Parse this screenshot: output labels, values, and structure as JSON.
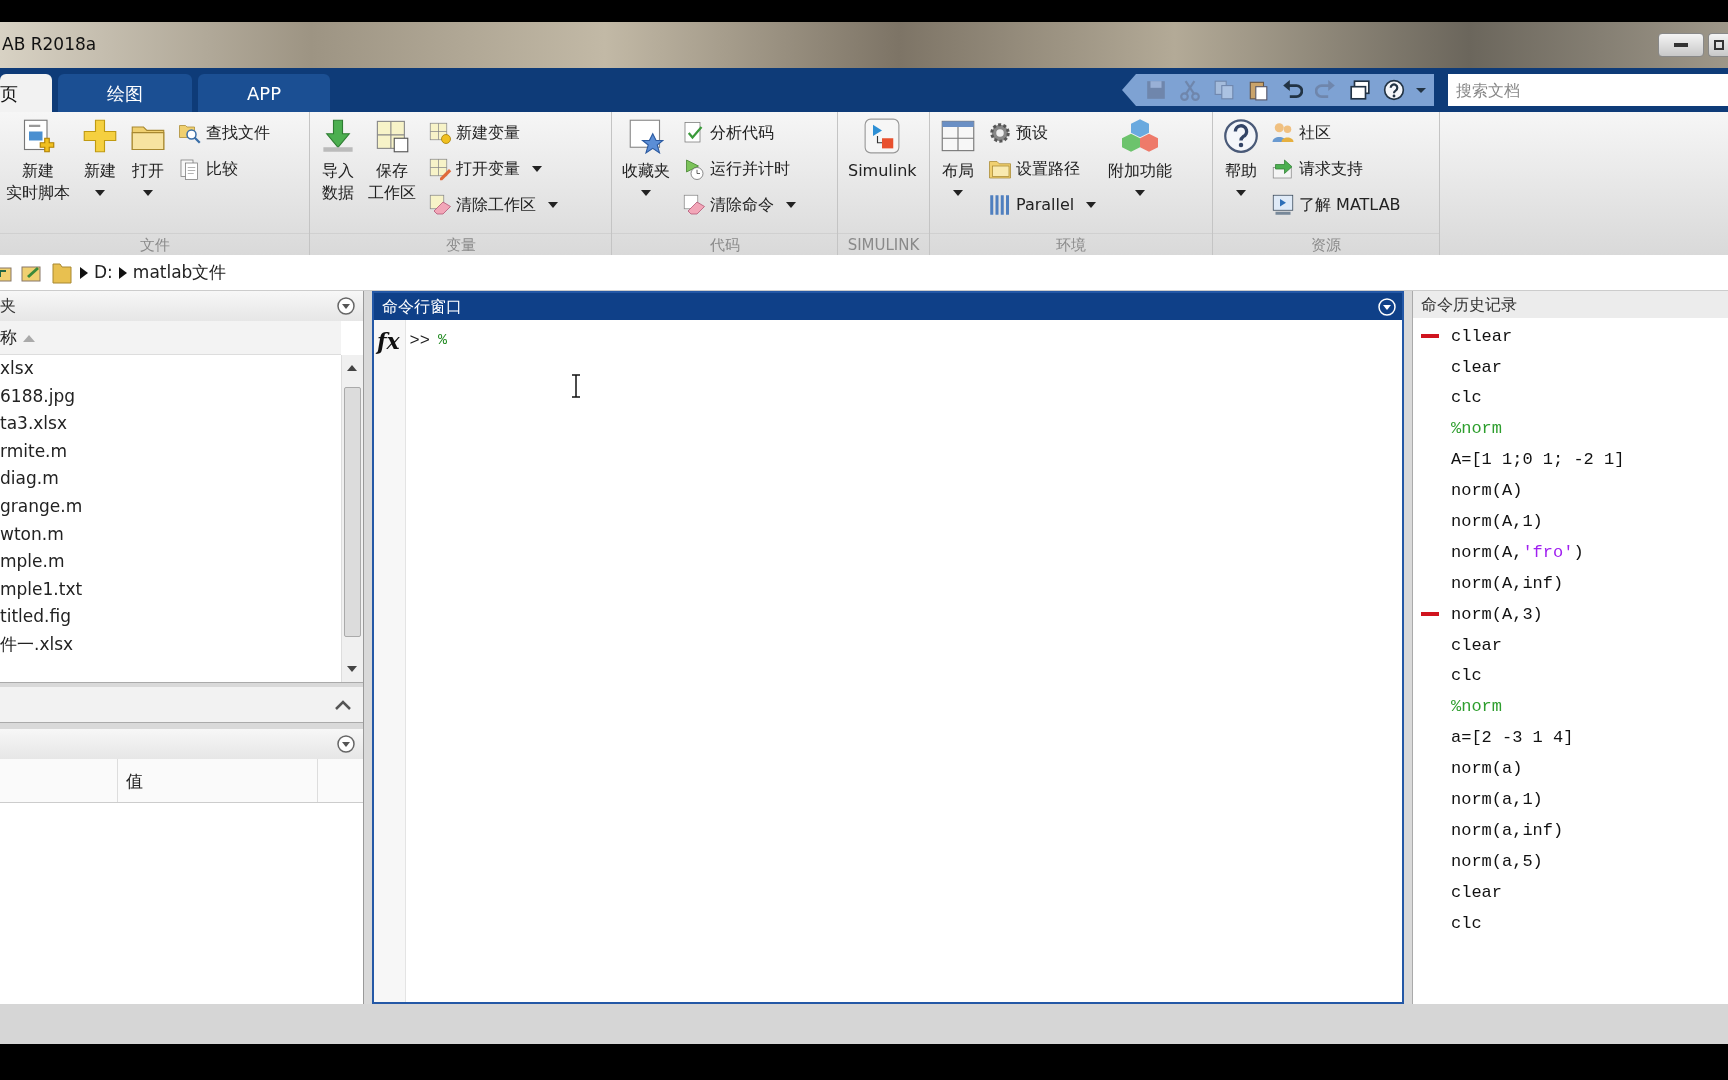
{
  "window": {
    "title": "AB R2018a"
  },
  "tabs": [
    {
      "label": "页",
      "selected": true
    },
    {
      "label": "绘图",
      "selected": false
    },
    {
      "label": "APP",
      "selected": false
    }
  ],
  "quick_access": [
    {
      "disabled": true
    },
    {
      "disabled": true
    },
    {
      "disabled": true
    },
    {
      "disabled": false
    },
    {
      "disabled": false
    },
    {
      "disabled": true
    },
    {
      "disabled": false
    },
    {
      "disabled": false
    },
    {
      "disabled": false
    }
  ],
  "search": {
    "placeholder": "搜索文档"
  },
  "ribbon": {
    "groups": [
      {
        "title": "文件",
        "items": [
          {
            "kind": "large",
            "lines": [
              "新建",
              "实时脚本"
            ],
            "dropdown": false
          },
          {
            "kind": "large",
            "lines": [
              "新建"
            ],
            "dropdown": true
          },
          {
            "kind": "large",
            "lines": [
              "打开"
            ],
            "dropdown": true
          },
          {
            "kind": "stack",
            "items": [
              {
                "label": "查找文件",
                "dropdown": false
              },
              {
                "label": "比较",
                "dropdown": false
              }
            ]
          }
        ]
      },
      {
        "title": "变量",
        "items": [
          {
            "kind": "large",
            "lines": [
              "导入",
              "数据"
            ],
            "dropdown": false
          },
          {
            "kind": "large",
            "lines": [
              "保存",
              "工作区"
            ],
            "dropdown": false
          },
          {
            "kind": "stack",
            "items": [
              {
                "label": "新建变量",
                "dropdown": false
              },
              {
                "label": "打开变量",
                "dropdown": true
              },
              {
                "label": "清除工作区",
                "dropdown": true
              }
            ]
          }
        ]
      },
      {
        "title": "代码",
        "items": [
          {
            "kind": "large",
            "lines": [
              "收藏夹"
            ],
            "dropdown": true
          },
          {
            "kind": "stack",
            "items": [
              {
                "label": "分析代码",
                "dropdown": false
              },
              {
                "label": "运行并计时",
                "dropdown": false
              },
              {
                "label": "清除命令",
                "dropdown": true
              }
            ]
          }
        ]
      },
      {
        "title": "SIMULINK",
        "items": [
          {
            "kind": "large",
            "lines": [
              "Simulink"
            ],
            "dropdown": false
          }
        ]
      },
      {
        "title": "环境",
        "items": [
          {
            "kind": "large",
            "lines": [
              "布局"
            ],
            "dropdown": true
          },
          {
            "kind": "stack",
            "items": [
              {
                "label": "预设",
                "dropdown": false
              },
              {
                "label": "设置路径",
                "dropdown": false
              },
              {
                "label": "Parallel",
                "dropdown": true
              }
            ]
          },
          {
            "kind": "large",
            "lines": [
              "附加功能"
            ],
            "dropdown": true
          }
        ]
      },
      {
        "title": "资源",
        "items": [
          {
            "kind": "large",
            "lines": [
              "帮助"
            ],
            "dropdown": true
          },
          {
            "kind": "stack",
            "items": [
              {
                "label": "社区",
                "dropdown": false
              },
              {
                "label": "请求支持",
                "dropdown": false
              },
              {
                "label": "了解 MATLAB",
                "dropdown": false
              }
            ]
          }
        ]
      }
    ]
  },
  "address_bar": {
    "path": [
      "D:",
      "matlab文件"
    ]
  },
  "current_folder": {
    "title": "夹",
    "column": "称",
    "files": [
      "xlsx",
      "6188.jpg",
      "ta3.xlsx",
      "rmite.m",
      "diag.m",
      "grange.m",
      "wton.m",
      "mple.m",
      "mple1.txt",
      "titled.fig",
      "件一.xlsx"
    ]
  },
  "workspace": {
    "columns": [
      "值"
    ]
  },
  "command_window": {
    "title": "命令行窗口",
    "function_button": "fx",
    "prompt": ">>",
    "input": "%"
  },
  "history": {
    "title": "命令历史记录",
    "items": [
      {
        "text": "cllear",
        "kind": "code",
        "error": true
      },
      {
        "text": "clear",
        "kind": "code",
        "error": false
      },
      {
        "text": "clc",
        "kind": "code",
        "error": false
      },
      {
        "text": "%norm",
        "kind": "comment",
        "error": false
      },
      {
        "text": "A=[1 1;0 1; -2 1]",
        "kind": "code",
        "error": false
      },
      {
        "text": "norm(A)",
        "kind": "code",
        "error": false
      },
      {
        "text": "norm(A,1)",
        "kind": "code",
        "error": false
      },
      {
        "kind": "code",
        "error": false,
        "parts": [
          {
            "text": "norm(A,",
            "kind": "code"
          },
          {
            "text": "'fro'",
            "kind": "string"
          },
          {
            "text": ")",
            "kind": "code"
          }
        ]
      },
      {
        "text": "norm(A,inf)",
        "kind": "code",
        "error": false
      },
      {
        "text": "norm(A,3)",
        "kind": "code",
        "error": true
      },
      {
        "text": "clear",
        "kind": "code",
        "error": false
      },
      {
        "text": "clc",
        "kind": "code",
        "error": false
      },
      {
        "text": "%norm",
        "kind": "comment",
        "error": false
      },
      {
        "text": "a=[2 -3 1 4]",
        "kind": "code",
        "error": false
      },
      {
        "text": "norm(a)",
        "kind": "code",
        "error": false
      },
      {
        "text": "norm(a,1)",
        "kind": "code",
        "error": false
      },
      {
        "text": "norm(a,inf)",
        "kind": "code",
        "error": false
      },
      {
        "text": "norm(a,5)",
        "kind": "code",
        "error": false
      },
      {
        "text": "clear",
        "kind": "code",
        "error": false
      },
      {
        "text": "clc",
        "kind": "code",
        "error": false
      }
    ]
  }
}
